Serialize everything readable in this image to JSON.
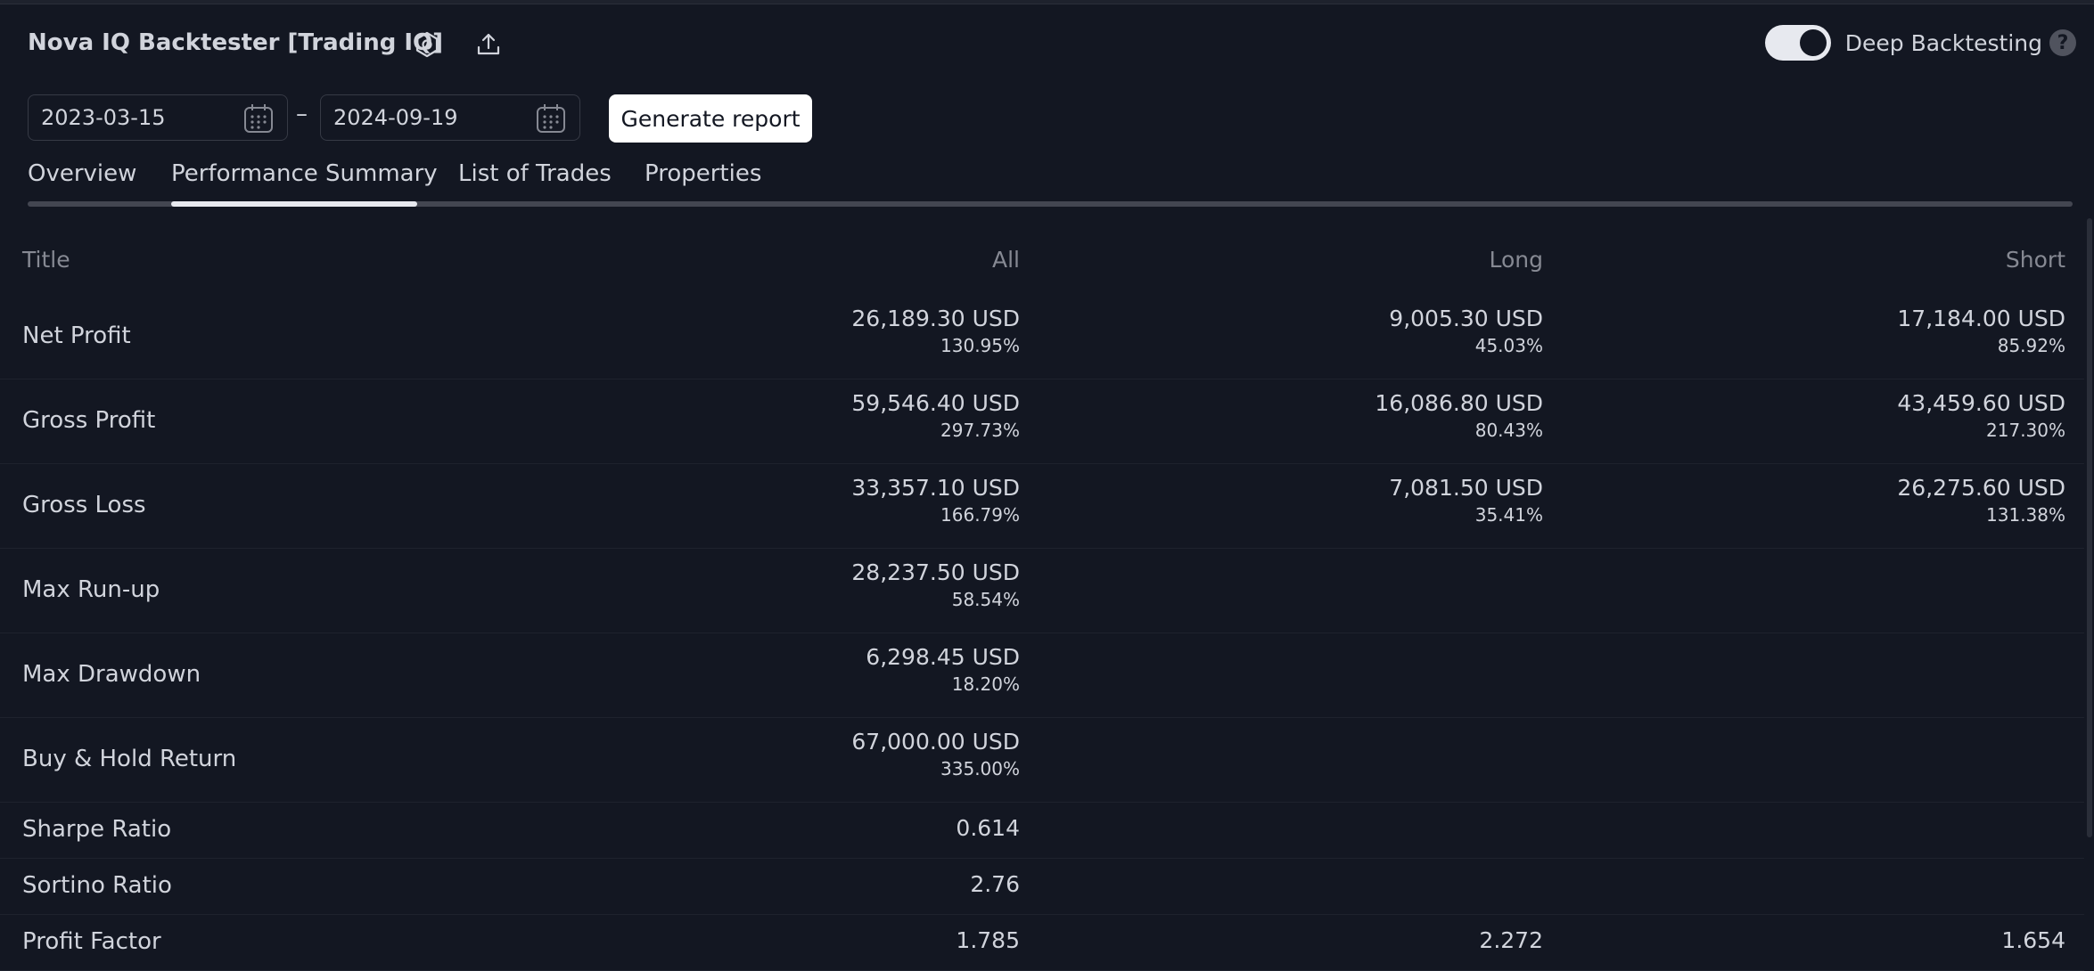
{
  "header": {
    "title": "Nova IQ Backtester [Trading IQ]",
    "settings_icon": "settings-icon",
    "export_icon": "export-icon",
    "deep_backtesting_label": "Deep Backtesting",
    "deep_backtesting_on": true,
    "help_glyph": "?"
  },
  "date_range": {
    "start": "2023-03-15",
    "separator": "–",
    "end": "2024-09-19",
    "generate_label": "Generate report"
  },
  "tabs": [
    {
      "label": "Overview",
      "active": false
    },
    {
      "label": "Performance Summary",
      "active": true
    },
    {
      "label": "List of Trades",
      "active": false
    },
    {
      "label": "Properties",
      "active": false
    }
  ],
  "table": {
    "columns": [
      "Title",
      "All",
      "Long",
      "Short"
    ],
    "rows": [
      {
        "title": "Net Profit",
        "all": {
          "value": "26,189.30 USD",
          "pct": "130.95%"
        },
        "long": {
          "value": "9,005.30 USD",
          "pct": "45.03%"
        },
        "short": {
          "value": "17,184.00 USD",
          "pct": "85.92%"
        }
      },
      {
        "title": "Gross Profit",
        "all": {
          "value": "59,546.40 USD",
          "pct": "297.73%"
        },
        "long": {
          "value": "16,086.80 USD",
          "pct": "80.43%"
        },
        "short": {
          "value": "43,459.60 USD",
          "pct": "217.30%"
        }
      },
      {
        "title": "Gross Loss",
        "all": {
          "value": "33,357.10 USD",
          "pct": "166.79%"
        },
        "long": {
          "value": "7,081.50 USD",
          "pct": "35.41%"
        },
        "short": {
          "value": "26,275.60 USD",
          "pct": "131.38%"
        }
      },
      {
        "title": "Max Run-up",
        "all": {
          "value": "28,237.50 USD",
          "pct": "58.54%"
        }
      },
      {
        "title": "Max Drawdown",
        "all": {
          "value": "6,298.45 USD",
          "pct": "18.20%"
        }
      },
      {
        "title": "Buy & Hold Return",
        "all": {
          "value": "67,000.00 USD",
          "pct": "335.00%"
        }
      },
      {
        "title": "Sharpe Ratio",
        "all": {
          "value": "0.614"
        }
      },
      {
        "title": "Sortino Ratio",
        "all": {
          "value": "2.76"
        }
      },
      {
        "title": "Profit Factor",
        "all": {
          "value": "1.785"
        },
        "long": {
          "value": "2.272"
        },
        "short": {
          "value": "1.654"
        }
      }
    ]
  },
  "colors": {
    "background": "#131722",
    "text": "#d1d4dc",
    "muted": "#868993",
    "border": "#363a45",
    "accent_white": "#ffffff"
  }
}
